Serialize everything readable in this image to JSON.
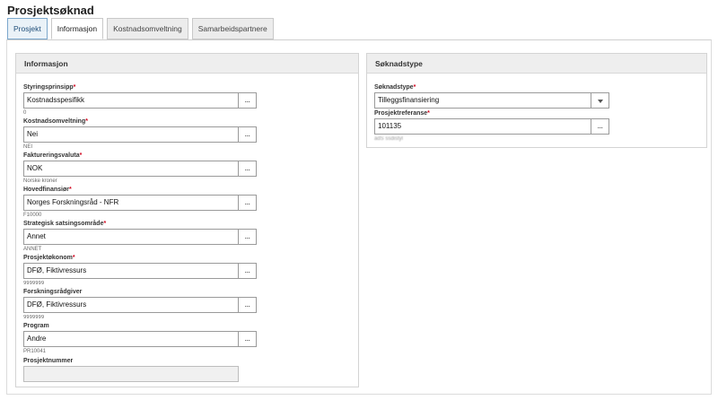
{
  "page": {
    "title": "Prosjektsøknad"
  },
  "tabs": [
    {
      "label": "Prosjekt"
    },
    {
      "label": "Informasjon"
    },
    {
      "label": "Kostnadsomveltning"
    },
    {
      "label": "Samarbeidspartnere"
    }
  ],
  "info_panel": {
    "title": "Informasjon",
    "fields": [
      {
        "label": "Styringsprinsipp",
        "required": "*",
        "value": "Kostnadsspesifikk",
        "sub": "0"
      },
      {
        "label": "Kostnadsomveltning",
        "required": "*",
        "value": "Nei",
        "sub": "NEI"
      },
      {
        "label": "Faktureringsvaluta",
        "required": "*",
        "value": "NOK",
        "sub": "Norske kroner"
      },
      {
        "label": "Hovedfinansiør",
        "required": "*",
        "value": "Norges Forskningsråd - NFR",
        "sub": "F10000"
      },
      {
        "label": "Strategisk satsingsområde",
        "required": "*",
        "value": "Annet",
        "sub": "ANNET"
      },
      {
        "label": "Prosjektøkonom",
        "required": "*",
        "value": "DFØ, Fiktivressurs",
        "sub": "9999999"
      },
      {
        "label": "Forskningsrådgiver",
        "required": "",
        "value": "DFØ, Fiktivressurs",
        "sub": "9999999"
      },
      {
        "label": "Program",
        "required": "",
        "value": "Andre",
        "sub": "PR10041"
      },
      {
        "label": "Prosjektnummer",
        "required": "",
        "value": ""
      }
    ]
  },
  "type_panel": {
    "title": "Søknadstype",
    "fields": [
      {
        "label": "Søknadstype",
        "required": "*",
        "value": "Tilleggsfinansiering"
      },
      {
        "label": "Prosjektreferanse",
        "required": "*",
        "value": "101135",
        "sub": "adS ssdistyl"
      }
    ]
  },
  "lookup_glyph": "...",
  "icons": {
    "lookup": "ellipsis-icon",
    "dropdown": "chevron-down-icon"
  },
  "colors": {
    "required": "#d0021b",
    "active_tab_border": "#7ba7cc"
  }
}
